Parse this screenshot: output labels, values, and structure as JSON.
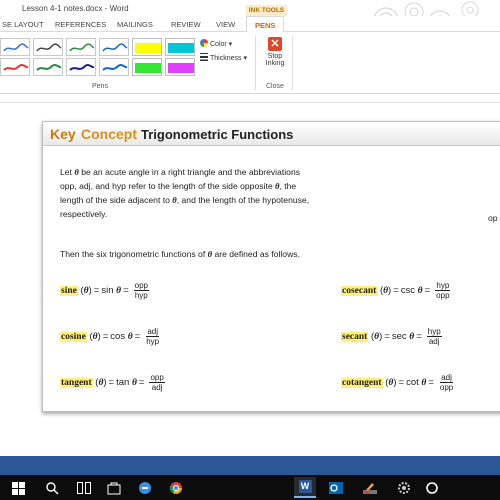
{
  "window": {
    "title": "Lesson 4-1 notes.docx - Word",
    "contextual_tab_group": "INK TOOLS"
  },
  "tabs": [
    {
      "label": "SE LAYOUT"
    },
    {
      "label": "REFERENCES"
    },
    {
      "label": "MAILINGS"
    },
    {
      "label": "REVIEW"
    },
    {
      "label": "VIEW"
    },
    {
      "label": "PENS"
    }
  ],
  "ribbon": {
    "color_label": "Color",
    "thickness_label": "Thickness",
    "pens_group_label": "Pens",
    "stop_inking_line1": "Stop",
    "stop_inking_line2": "Inking",
    "close_group_label": "Close",
    "pen_colors": [
      "#2f6fd6",
      "#444444",
      "#2b8a3e",
      "#1565c0",
      "#ffff00",
      "#00c8d6",
      "#e53935",
      "#2b8a3e",
      "#1a237e",
      "#1565c0",
      "#33e633",
      "#e040fb"
    ]
  },
  "key_concept": {
    "key": "Key",
    "concept": "Concept",
    "title": "Trigonometric Functions",
    "intro_line1_pre": "Let ",
    "intro_theta": "θ",
    "intro_line1_post": " be an acute angle in a right triangle and the abbreviations",
    "intro_line2_pre": "opp, adj, and hyp refer to the length of the side opposite ",
    "intro_line2_post": ", the",
    "intro_line3_pre": "length of the side adjacent to ",
    "intro_line3_post": ", and the length of the hypotenuse,",
    "intro_line4": "respectively.",
    "defined_pre": "Then the six trigonometric functions of ",
    "defined_post": " are defined as follows.",
    "edge_text": "op"
  },
  "functions": [
    {
      "name": "sine",
      "abbr": "sin",
      "num": "opp",
      "den": "hyp"
    },
    {
      "name": "cosecant",
      "abbr": "csc",
      "num": "hyp",
      "den": "opp"
    },
    {
      "name": "cosine",
      "abbr": "cos",
      "num": "adj",
      "den": "hyp"
    },
    {
      "name": "secant",
      "abbr": "sec",
      "num": "hyp",
      "den": "adj"
    },
    {
      "name": "tangent",
      "abbr": "tan",
      "num": "opp",
      "den": "adj"
    },
    {
      "name": "cotangent",
      "abbr": "cot",
      "num": "adj",
      "den": "opp"
    }
  ],
  "symbols": {
    "theta": "θ",
    "open": "(",
    "close": ")",
    "equals": "="
  },
  "taskbar": {
    "icons": [
      "windows-icon",
      "search-icon",
      "task-view-icon",
      "store-icon",
      "edge-icon",
      "chrome-icon",
      "word-icon",
      "outlook-icon",
      "paint-icon",
      "gear-icon",
      "cortana-icon"
    ],
    "word_letter": "W"
  }
}
